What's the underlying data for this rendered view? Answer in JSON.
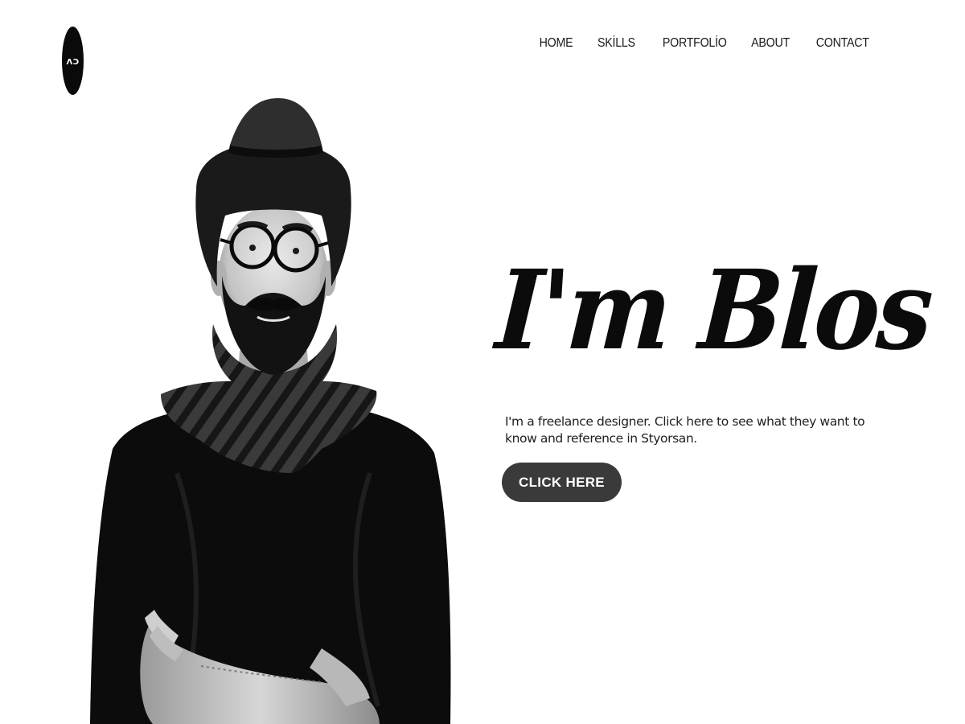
{
  "logo": {
    "text": "CV"
  },
  "nav": {
    "home": "HOME",
    "skills": "SKİLLS",
    "portfolio": "PORTFOLİO",
    "about": "ABOUT",
    "contact": "CONTACT"
  },
  "hero": {
    "title": "I'm Blos",
    "description": "I'm a freelance designer. Click here to see what they want to know and reference in Styorsan.",
    "cta_label": "CLICK HERE"
  },
  "colors": {
    "background": "#ffffff",
    "text": "#0b0b0b",
    "button": "#3a3a3a",
    "button_text": "#ffffff"
  }
}
